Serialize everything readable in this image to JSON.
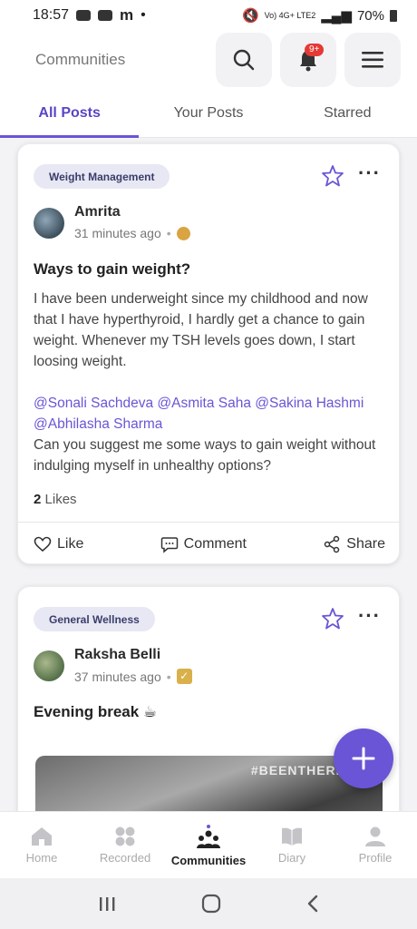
{
  "status_bar": {
    "time": "18:57",
    "m_icon": "m",
    "dot": "•",
    "signal_text": "Vo) 4G+ LTE2",
    "battery": "70%"
  },
  "header": {
    "title": "Communities",
    "notification_badge": "9+"
  },
  "tabs": [
    {
      "label": "All Posts",
      "active": true
    },
    {
      "label": "Your Posts",
      "active": false
    },
    {
      "label": "Starred",
      "active": false
    }
  ],
  "posts": [
    {
      "category": "Weight Management",
      "author": "Amrita",
      "time": "31 minutes ago",
      "title": "Ways to gain weight?",
      "body": "I have been underweight since my childhood and now that I have hyperthyroid, I hardly get a chance to gain weight. Whenever my TSH levels goes down, I start loosing weight.",
      "mentions": "@Sonali Sachdeva @Asmita Saha @Sakina Hashmi @Abhilasha Sharma",
      "body2": "Can you suggest me some ways to gain weight without indulging myself in unhealthy options?",
      "likes_count": "2",
      "likes_label": "Likes",
      "actions": {
        "like": "Like",
        "comment": "Comment",
        "share": "Share"
      }
    },
    {
      "category": "General Wellness",
      "author": "Raksha Belli",
      "time": "37 minutes ago",
      "title": "Evening break ☕",
      "media_watermark": "#BEENTHERESEE"
    }
  ],
  "bottom_nav": [
    {
      "label": "Home",
      "icon": "home-icon"
    },
    {
      "label": "Recorded",
      "icon": "recorded-icon"
    },
    {
      "label": "Communities",
      "icon": "communities-icon",
      "active": true
    },
    {
      "label": "Diary",
      "icon": "diary-icon"
    },
    {
      "label": "Profile",
      "icon": "profile-icon"
    }
  ],
  "colors": {
    "accent": "#6a55d6",
    "badge": "#e53935"
  }
}
